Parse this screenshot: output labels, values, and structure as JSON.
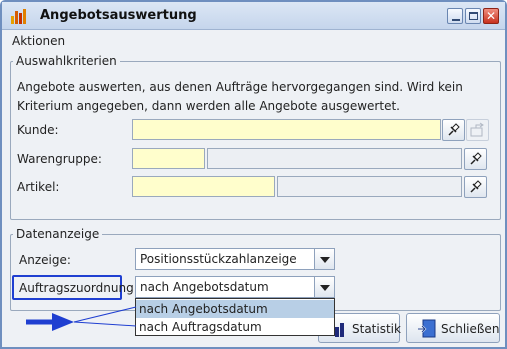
{
  "window": {
    "title": "Angebotsauswertung",
    "close_glyph": "✕"
  },
  "menu": {
    "items": [
      "Aktionen"
    ]
  },
  "selection_criteria": {
    "legend": "Auswahlkriterien",
    "info_line1": "Angebote auswerten, aus denen Aufträge hervorgegangen sind. Wird kein",
    "info_line2": "Kriterium angegeben, dann werden alle Angebote ausgewertet.",
    "customer_label": "Kunde:",
    "product_group_label": "Warengruppe:",
    "article_label": "Artikel:"
  },
  "data_display": {
    "legend": "Datenanzeige",
    "display_label": "Anzeige:",
    "display_value": "Positionsstückzahlanzeige",
    "assignment_label": "Auftragszuordnung:",
    "assignment_value": "nach Angebotsdatum",
    "assignment_options": [
      "nach Angebotsdatum",
      "nach Auftragsdatum"
    ],
    "highlighted_option": "nach Angebotsdatum"
  },
  "buttons": {
    "statistics": "Statistik",
    "close": "Schließen"
  },
  "colors": {
    "required_field": "#fffecc",
    "annotation_arrow": "#1f3fd1",
    "selected_option": "#b8cfe6"
  },
  "icons": [
    "bar-chart-icon",
    "minimize-icon",
    "maximize-icon",
    "close-icon",
    "pin-icon",
    "open-record-icon",
    "statistics-icon",
    "exit-icon",
    "annotation-arrow-icon"
  ]
}
